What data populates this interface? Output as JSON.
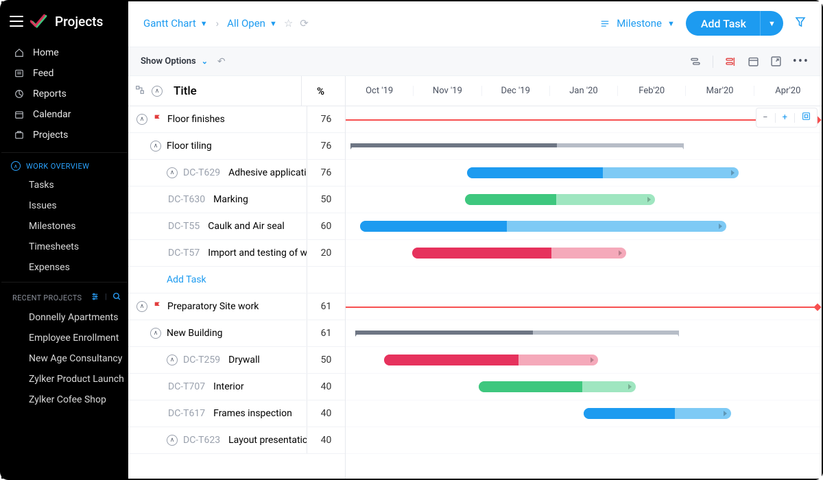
{
  "app": {
    "title": "Projects"
  },
  "nav": {
    "home": "Home",
    "feed": "Feed",
    "reports": "Reports",
    "calendar": "Calendar",
    "projects": "Projects"
  },
  "work_overview": {
    "heading": "WORK OVERVIEW",
    "items": [
      "Tasks",
      "Issues",
      "Milestones",
      "Timesheets",
      "Expenses"
    ]
  },
  "recent": {
    "heading": "RECENT PROJECTS",
    "items": [
      "Donnelly Apartments",
      "Employee Enrollment",
      "New Age Consultancy",
      "Zylker Product Launch",
      "Zylker Cofee Shop"
    ]
  },
  "breadcrumb": {
    "gantt": "Gantt Chart",
    "filter": "All Open"
  },
  "header": {
    "milestone": "Milestone",
    "add_task": "Add Task"
  },
  "subbar": {
    "show_options": "Show Options"
  },
  "columns": {
    "title": "Title",
    "percent": "%"
  },
  "months": [
    "Oct '19",
    "Nov '19",
    "Dec '19",
    "Jan '20",
    "Feb'20",
    "Mar'20",
    "Apr'20"
  ],
  "add_task_link": "Add Task",
  "rows": [
    {
      "type": "milestone",
      "indent": 0,
      "label": "Floor finishes",
      "pct": "76"
    },
    {
      "type": "summary",
      "indent": 1,
      "label": "Floor tiling",
      "pct": "76"
    },
    {
      "type": "task",
      "indent": 2,
      "id": "DC-T629",
      "label": "Adhesive application",
      "pct": "76"
    },
    {
      "type": "task",
      "indent": 3,
      "id": "DC-T630",
      "label": "Marking",
      "pct": "50"
    },
    {
      "type": "task",
      "indent": 3,
      "id": "DC-T55",
      "label": "Caulk and Air seal",
      "pct": "60"
    },
    {
      "type": "task",
      "indent": 3,
      "id": "DC-T57",
      "label": "Import and testing of woo..",
      "pct": "20"
    },
    {
      "type": "add",
      "indent": 2
    },
    {
      "type": "milestone",
      "indent": 0,
      "label": "Preparatory Site work",
      "pct": "61"
    },
    {
      "type": "summary",
      "indent": 1,
      "label": "New Building",
      "pct": "61"
    },
    {
      "type": "task",
      "indent": 2,
      "id": "DC-T259",
      "label": "Drywall",
      "pct": "50"
    },
    {
      "type": "task",
      "indent": 3,
      "id": "DC-T707",
      "label": "Interior",
      "pct": "40"
    },
    {
      "type": "task",
      "indent": 3,
      "id": "DC-T617",
      "label": "Frames inspection",
      "pct": "40"
    },
    {
      "type": "task",
      "indent": 2,
      "id": "DC-T623",
      "label": "Layout presentation",
      "pct": "40"
    }
  ],
  "chart_data": {
    "type": "gantt",
    "x_axis": [
      "Oct '19",
      "Nov '19",
      "Dec '19",
      "Jan '20",
      "Feb'20",
      "Mar'20",
      "Apr'20"
    ],
    "bars": [
      {
        "row": 0,
        "kind": "milestone",
        "start": 0,
        "width": 100,
        "color": "#f75050"
      },
      {
        "row": 1,
        "kind": "summary",
        "start": 1,
        "width": 70,
        "progress": 62
      },
      {
        "row": 2,
        "kind": "task",
        "start": 25.5,
        "width": 57,
        "progress": 50,
        "color": "#1d9bf0",
        "light": "#7ecaf5"
      },
      {
        "row": 3,
        "kind": "task",
        "start": 25,
        "width": 40,
        "progress": 48,
        "color": "#3ec77e",
        "light": "#9fe6c0"
      },
      {
        "row": 4,
        "kind": "task",
        "start": 3,
        "width": 77,
        "progress": 40,
        "color": "#1d9bf0",
        "light": "#7ecaf5"
      },
      {
        "row": 5,
        "kind": "task",
        "start": 14,
        "width": 45,
        "progress": 65,
        "color": "#e6325d",
        "light": "#f5a9ba"
      },
      {
        "row": 7,
        "kind": "milestone",
        "start": 0,
        "width": 100,
        "color": "#f75050"
      },
      {
        "row": 8,
        "kind": "summary",
        "start": 2,
        "width": 68,
        "progress": 55
      },
      {
        "row": 9,
        "kind": "task",
        "start": 8,
        "width": 45,
        "progress": 63,
        "color": "#e6325d",
        "light": "#f5a9ba"
      },
      {
        "row": 10,
        "kind": "task",
        "start": 28,
        "width": 33,
        "progress": 66,
        "color": "#3ec77e",
        "light": "#9fe6c0"
      },
      {
        "row": 11,
        "kind": "task",
        "start": 50,
        "width": 31,
        "progress": 62,
        "color": "#1d9bf0",
        "light": "#7ecaf5"
      }
    ]
  }
}
